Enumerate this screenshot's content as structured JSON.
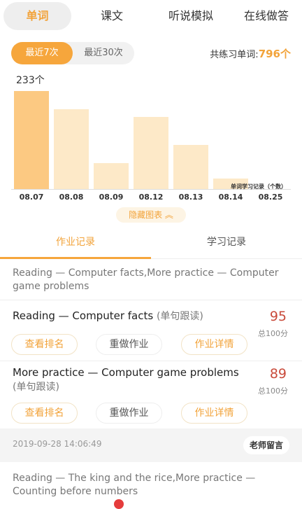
{
  "top_tabs": [
    "单词",
    "课文",
    "听说模拟",
    "在线做答"
  ],
  "period_chips": [
    "最近7次",
    "最近30次"
  ],
  "total": {
    "label": "共练习单词:",
    "value": "796个"
  },
  "chart_data": {
    "type": "bar",
    "categories": [
      "08.07",
      "08.08",
      "08.09",
      "08.12",
      "08.13",
      "08.14",
      "08.25"
    ],
    "values": [
      233,
      190,
      62,
      172,
      105,
      25,
      0
    ],
    "peak_label": "233个",
    "note": "单词学习记录（个数）",
    "colors": {
      "highlight": "#fcc982",
      "normal": "#fde9c8"
    }
  },
  "hide_chart_label": "隐藏图表 ︽",
  "sub_tabs": [
    "作业记录",
    "学习记录"
  ],
  "summary": "Reading — Computer facts,More practice — Computer game problems",
  "records": [
    {
      "title": "Reading — Computer facts",
      "mode": "(单句跟读)",
      "score": "95",
      "total": "总100分",
      "actions": [
        "查看排名",
        "重做作业",
        "作业详情"
      ]
    },
    {
      "title": "More practice — Computer game problems",
      "mode": "(单句跟读)",
      "score": "89",
      "total": "总100分",
      "actions": [
        "查看排名",
        "重做作业",
        "作业详情"
      ]
    }
  ],
  "date_strip": {
    "date": "2019-09-28 14:06:49",
    "button": "老师留言"
  },
  "last_item": "Reading — The king and the rice,More practice — Counting before numbers",
  "accent_color": "#f6a63c",
  "score_color": "#c94a3a"
}
